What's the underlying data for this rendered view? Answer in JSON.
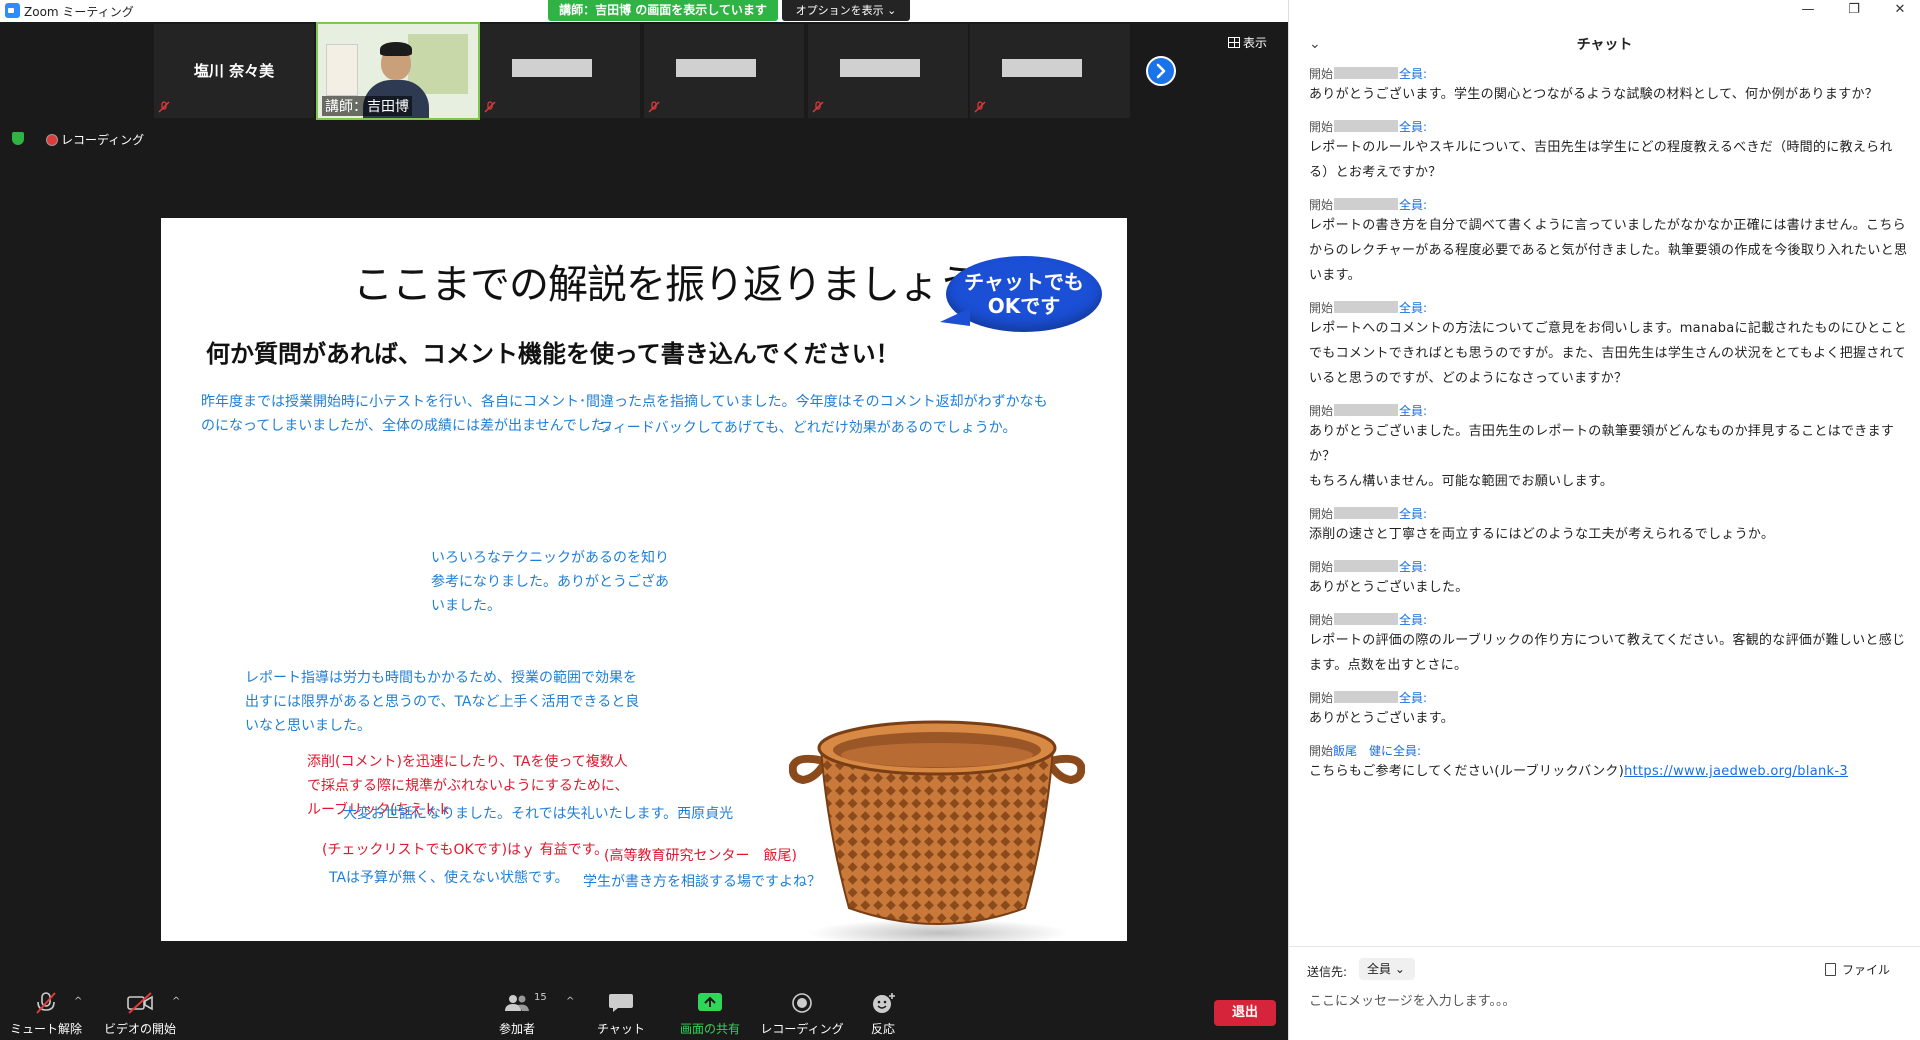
{
  "window": {
    "app_title": "Zoom ミーティング",
    "share_banner": "講師：吉田博 の画面を表示しています",
    "options_button": "オプションを表示",
    "view_button": "表示"
  },
  "participants": [
    {
      "name": "塩川 奈々美",
      "video": false,
      "muted": true
    },
    {
      "name": "講師：吉田博",
      "video": true,
      "muted": false
    },
    {
      "name": "",
      "video": false,
      "muted": true,
      "redacted": true
    },
    {
      "name": "",
      "video": false,
      "muted": true,
      "redacted": true
    },
    {
      "name": "",
      "video": false,
      "muted": true,
      "redacted": true
    },
    {
      "name": "",
      "video": false,
      "muted": true,
      "redacted": true
    }
  ],
  "status": {
    "recording_label": "レコーディング"
  },
  "slide": {
    "title": "ここまでの解説を振り返りましょう！",
    "bubble_line1": "チャットでも",
    "bubble_line2": "OKです",
    "subtitle": "何か質問があれば、コメント機能を使って書き込んでください！",
    "notes": [
      "昨年度までは授業開始時に小テストを行い、各自にコメント･間違った点を指摘していました。今年度はそのコメント返却がわずかなものになってしまいましたが、全体の成績には差が出ませんでした。",
      "フィードバックしてあげても、どれだけ効果があるのでしょうか。",
      "いろいろなテクニックがあるのを知り参考になりました。ありがとうござあいました。",
      "レポート指導は労力も時間もかかるため、授業の範囲で効果を出すには限界があると思うので、TAなど上手く活用できると良いなと思いました。",
      "添削(コメント)を迅速にしたり、TAを使って複数人で採点する際に規準がぶれないようにするために、ルーブリック(ちえｋｋ",
      "大変お世話になりました。それでは失礼いたします。西原貞光",
      "(チェックリストでもOKです)はｙ 有益です。",
      "(高等教育研究センター　飯尾)",
      "TAは予算が無く、使えない状態です。",
      "学生が書き方を相談する場ですよね？"
    ]
  },
  "toolbar": {
    "unmute": "ミュート解除",
    "start_video": "ビデオの開始",
    "participants": "参加者",
    "participants_count": "15",
    "chat": "チャット",
    "share_screen": "画面の共有",
    "recording": "レコーディング",
    "reactions": "反応",
    "leave": "退出"
  },
  "chat": {
    "title": "チャット",
    "messages": [
      {
        "prefix": "開始",
        "to": "全員:",
        "text": "ありがとうございます。学生の関心とつながるような試験の材料として、何か例がありますか？"
      },
      {
        "prefix": "開始",
        "to": "全員:",
        "text": "レポートのルールやスキルについて、吉田先生は学生にどの程度教えるべきだ（時間的に教えられる）とお考えですか？"
      },
      {
        "prefix": "開始",
        "to": "全員:",
        "text": "レポートの書き方を自分で調べて書くように言っていましたがなかなか正確には書けません。こちらからのレクチャーがある程度必要であると気が付きました。執筆要領の作成を今後取り入れたいと思います。"
      },
      {
        "prefix": "開始",
        "to": "全員:",
        "text": "レポートへのコメントの方法についてご意見をお伺いします。manabaに記載されたものにひとことでもコメントできればとも思うのですが。また、吉田先生は学生さんの状況をとてもよく把握されていると思うのですが、どのようになさっていますか？"
      },
      {
        "prefix": "開始",
        "to": "全員:",
        "text": "ありがとうございました。吉田先生のレポートの執筆要領がどんなものか拝見することはできますか？",
        "text2": "もちろん構いません。可能な範囲でお願いします。"
      },
      {
        "prefix": "開始",
        "to": "全員:",
        "text": "添削の速さと丁寧さを両立するにはどのような工夫が考えられるでしょうか。"
      },
      {
        "prefix": "開始",
        "to": "全員:",
        "text": "ありがとうございました。"
      },
      {
        "prefix": "開始",
        "to": "全員:",
        "text": "レポートの評価の際のルーブリックの作り方について教えてください。客観的な評価が難しいと感じます。点数を出すとさに。"
      },
      {
        "prefix": "開始",
        "to": "全員:",
        "text": "ありがとうございます。"
      },
      {
        "prefix": "開始",
        "sender": "飯尾　健",
        "to": "に全員:",
        "text": "こちらもご参考にしてください(ルーブリックバンク)",
        "link": "https://www.jaedweb.org/blank-3"
      }
    ],
    "send_to_label": "送信先:",
    "send_to_value": "全員",
    "file_button": "ファイル",
    "input_placeholder": "ここにメッセージを入力します。。。"
  }
}
